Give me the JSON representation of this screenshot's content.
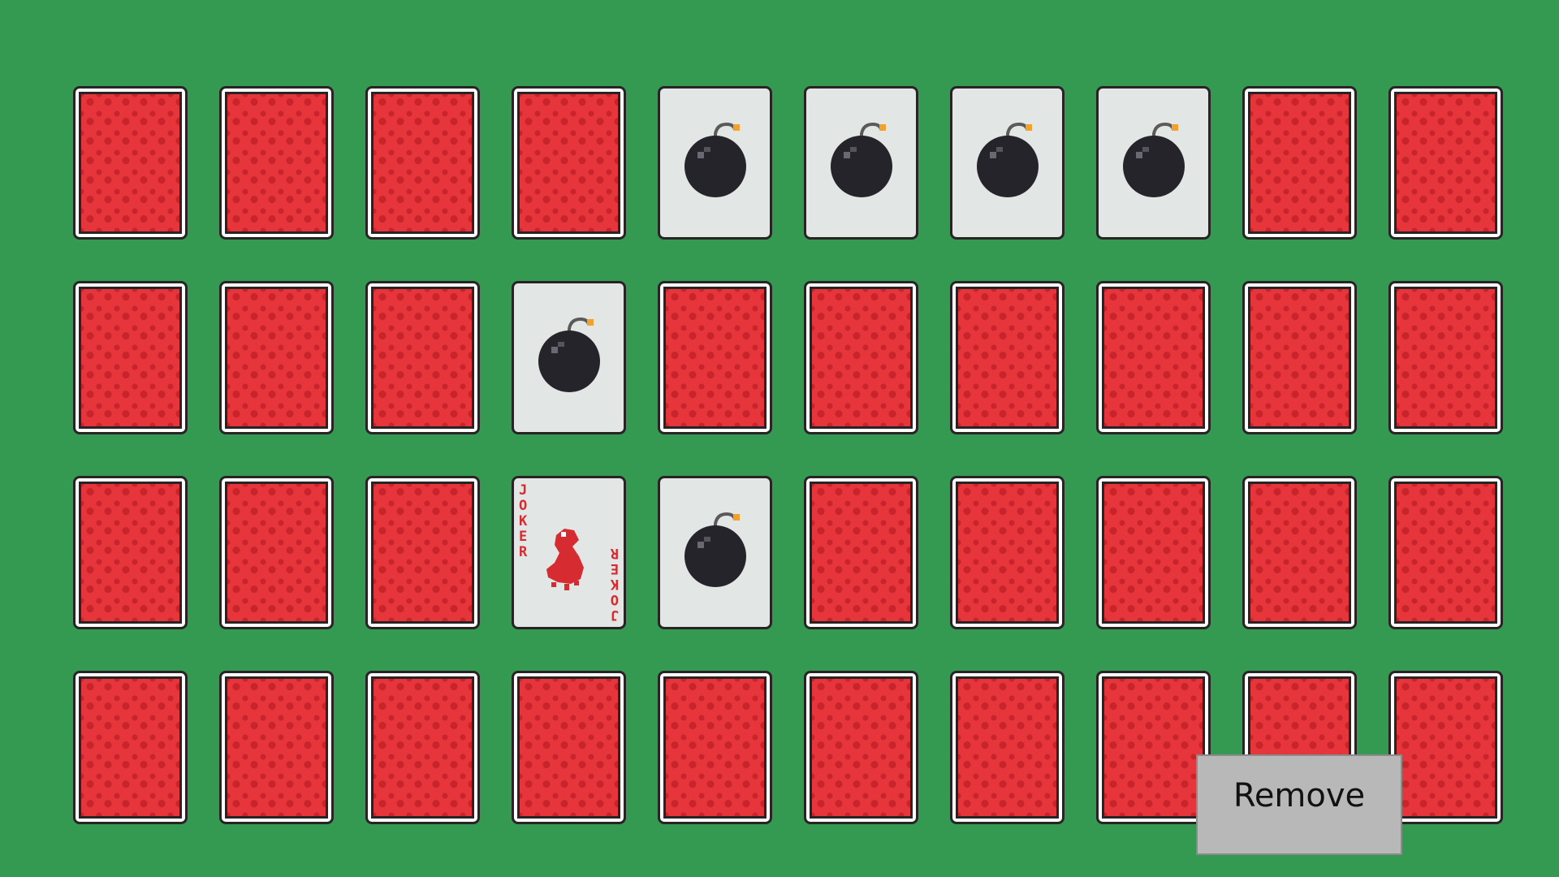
{
  "colors": {
    "felt": "#349a51",
    "card_back": "#e6353b",
    "card_back_pattern": "#c8242b",
    "card_face": "#e2e6e4",
    "card_outline": "#2a2326",
    "bomb": "#26242b",
    "fuse_spark": "#f2a22a",
    "joker_red": "#d62b31",
    "button_bg": "#b8b8b8"
  },
  "board": {
    "rows": 4,
    "cols": 10,
    "cards": [
      [
        "back",
        "back",
        "back",
        "back",
        "bomb",
        "bomb",
        "bomb",
        "bomb",
        "back",
        "back"
      ],
      [
        "back",
        "back",
        "back",
        "bomb",
        "back",
        "back",
        "back",
        "back",
        "back",
        "back"
      ],
      [
        "back",
        "back",
        "back",
        "joker",
        "bomb",
        "back",
        "back",
        "back",
        "back",
        "back"
      ],
      [
        "back",
        "back",
        "back",
        "back",
        "back",
        "back",
        "back",
        "back",
        "back",
        "back"
      ]
    ],
    "icons": {
      "back": "card-back-pattern",
      "bomb": "bomb-icon",
      "joker": "joker-figure-icon"
    }
  },
  "joker_card": {
    "label": "JOKER"
  },
  "remove_button": {
    "label": "Remove"
  }
}
